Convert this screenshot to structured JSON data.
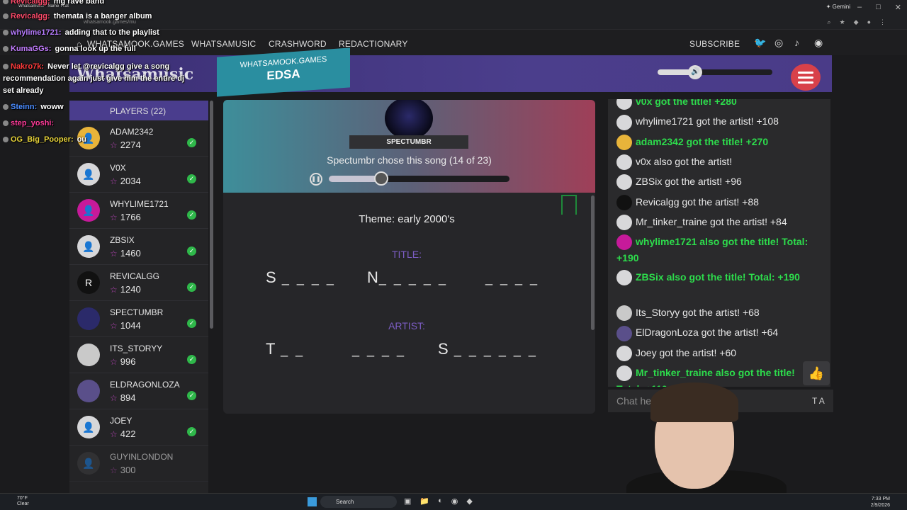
{
  "browser": {
    "tab_title": "Whatsamusic - Name That",
    "url": "whatsamook.games/mu",
    "gemini_label": "Gemini"
  },
  "nav": {
    "items": [
      "WHATSAMOOK.GAMES",
      "WHATSAMUSIC",
      "CRASHWORD",
      "REDACTIONARY"
    ],
    "subscribe": "SUBSCRIBE"
  },
  "header": {
    "logo": "Whatsamusic",
    "game_domain": "WHATSAMOOK.GAMES",
    "room_code": "EDSA",
    "volume_level": 0.33
  },
  "players": {
    "header": "PLAYERS (22)",
    "list": [
      {
        "name": "ADAM2342",
        "score": "2274",
        "color": "#e8b43a",
        "icon": "user-icon"
      },
      {
        "name": "V0X",
        "score": "2034",
        "color": "#d7d7d9",
        "icon": "user-icon"
      },
      {
        "name": "WHYLIME1721",
        "score": "1766",
        "color": "#c61a9a",
        "icon": "user-icon"
      },
      {
        "name": "ZBSIX",
        "score": "1460",
        "color": "#d7d7d9",
        "icon": "user-icon"
      },
      {
        "name": "REVICALGG",
        "score": "1240",
        "color": "#111111",
        "icon": "r-logo-icon"
      },
      {
        "name": "SPECTUMBR",
        "score": "1044",
        "color": "#2b2a6a",
        "icon": "hooded-figure-icon"
      },
      {
        "name": "ITS_STORYY",
        "score": "996",
        "color": "#c9c9c9",
        "icon": "photo-icon"
      },
      {
        "name": "ELDRAGONLOZA",
        "score": "894",
        "color": "#5a4f8a",
        "icon": "photo-icon"
      },
      {
        "name": "JOEY",
        "score": "422",
        "color": "#d7d7d9",
        "icon": "user-icon"
      },
      {
        "name": "GUYINLONDON",
        "score": "300",
        "color": "#3a3a3d",
        "icon": "user-icon"
      }
    ]
  },
  "song": {
    "host": "SPECTUMBR",
    "chose_text": "Spectumbr chose this song (14 of 23)",
    "progress": 0.29,
    "theme": "Theme: early 2000's",
    "title_label": "TITLE:",
    "artist_label": "ARTIST:",
    "title_words": [
      {
        "letter": "S",
        "blanks": "_ _ _ _"
      },
      {
        "letter": "N",
        "blanks": "_ _ _ _ _"
      },
      {
        "letter": "",
        "blanks": "_ _ _ _"
      }
    ],
    "artist_words": [
      {
        "letter": "T",
        "blanks": "_ _"
      },
      {
        "letter": "",
        "blanks": "_ _ _ _"
      },
      {
        "letter": "S",
        "blanks": "_ _ _ _ _ _"
      }
    ]
  },
  "chat": {
    "messages": [
      {
        "text": "v0x got the title! +280",
        "green": true,
        "color": "#d8d8da"
      },
      {
        "text": "whylime1721 got the artist! +108",
        "green": false,
        "color": "#d8d8da"
      },
      {
        "text": "adam2342 got the title! +270",
        "green": true,
        "color": "#e8b43a"
      },
      {
        "text": "v0x also got the artist!",
        "green": false,
        "color": "#d8d8da"
      },
      {
        "text": "ZBSix got the artist! +96",
        "green": false,
        "color": "#d8d8da"
      },
      {
        "text": "Revicalgg got the artist! +88",
        "green": false,
        "color": "#111111"
      },
      {
        "text": "Mr_tinker_traine got the artist! +84",
        "green": false,
        "color": "#d8d8da"
      },
      {
        "text": "whylime1721 also got the title! Total: +190",
        "green": true,
        "color": "#c61a9a"
      },
      {
        "text": "ZBSix also got the title! Total: +190",
        "green": true,
        "color": "#d8d8da"
      },
      {
        "text": "Its_Storyy got the artist! +68",
        "green": false,
        "color": "#c9c9c9"
      },
      {
        "text": "ElDragonLoza got the artist! +64",
        "green": false,
        "color": "#5a4f8a"
      },
      {
        "text": "Joey got the artist! +60",
        "green": false,
        "color": "#d8d8da"
      },
      {
        "text": "Mr_tinker_traine also got the title! Total: +110",
        "green": true,
        "color": "#d8d8da"
      }
    ],
    "input_placeholder": "Chat here",
    "tools": "T A"
  },
  "stream_overlay": [
    {
      "user": "Revicalgg:",
      "text": "mg rave band",
      "color": "#ff4b6b"
    },
    {
      "user": "Revicalgg:",
      "text": "themata is a banger album",
      "color": "#ff4b6b"
    },
    {
      "user": "whylime1721:",
      "text": "adding that to the playlist",
      "color": "#b77cff"
    },
    {
      "user": "KumaGGs:",
      "text": "gonna look up the full",
      "color": "#c37dff"
    },
    {
      "user": "Nakro7k:",
      "text": "Never let @revicalgg give a song recommendation again just give him the entire dj set already",
      "color": "#ff3b3b"
    },
    {
      "user": "Steinn:",
      "text": "woww",
      "color": "#4a8cff"
    },
    {
      "user": "step_yoshi:",
      "text": "",
      "color": "#ff3b9a"
    },
    {
      "user": "OG_Big_Pooper:",
      "text": "ou",
      "color": "#e8d43a"
    }
  ],
  "taskbar": {
    "weather_temp": "70°F",
    "weather_desc": "Clear",
    "search": "Search",
    "time": "7:33 PM",
    "date": "2/9/2026"
  },
  "colors": {
    "accent_purple": "#4a3d8d",
    "header_red": "#d8414a",
    "badge_teal": "#2a8ea0",
    "correct_green": "#2ddc4c"
  }
}
